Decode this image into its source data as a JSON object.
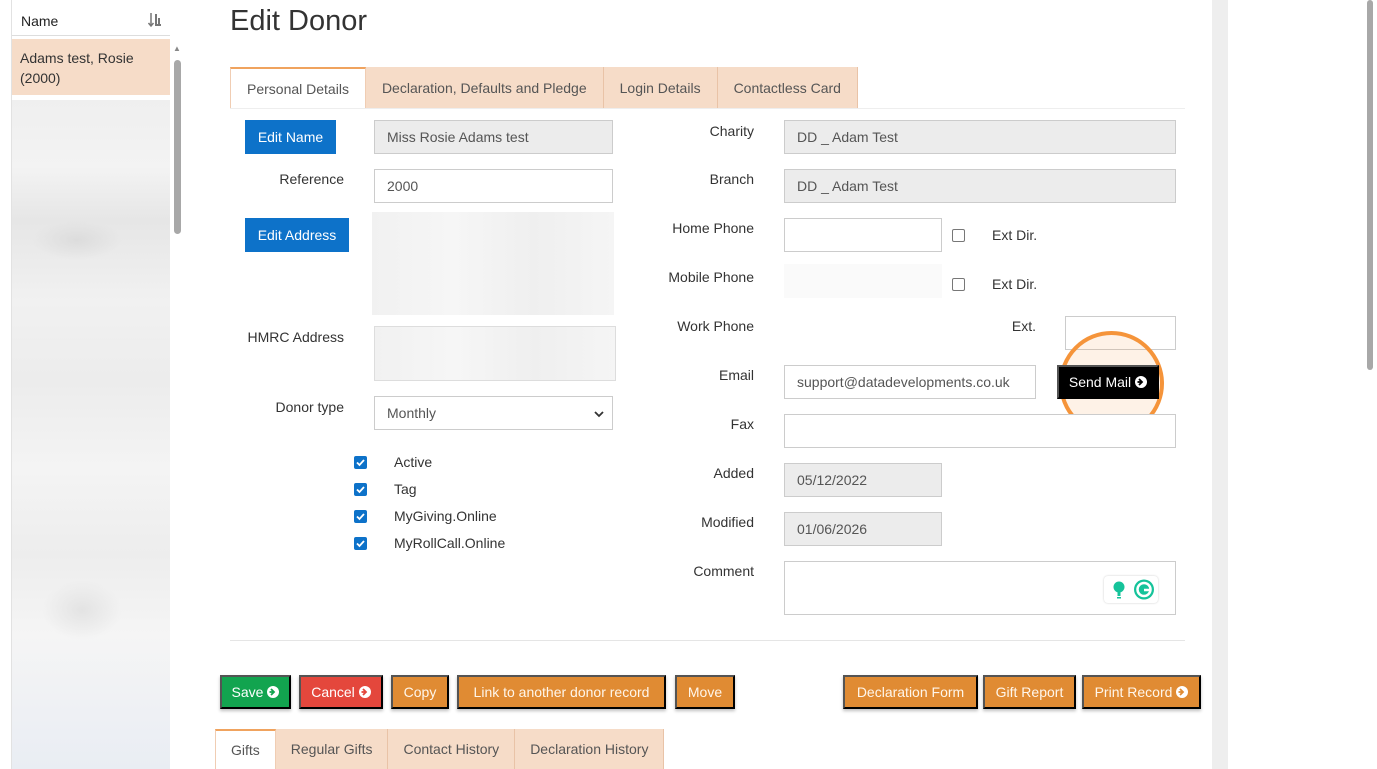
{
  "sidebar": {
    "header_label": "Name",
    "selected_item": "Adams test, Rosie (2000)"
  },
  "page": {
    "title": "Edit Donor"
  },
  "tabs": [
    {
      "label": "Personal Details",
      "active": true
    },
    {
      "label": "Declaration, Defaults and Pledge",
      "active": false
    },
    {
      "label": "Login Details",
      "active": false
    },
    {
      "label": "Contactless Card",
      "active": false
    }
  ],
  "left_form": {
    "edit_name_label": "Edit Name",
    "name_value": "Miss Rosie Adams test",
    "reference_label": "Reference",
    "reference_value": "2000",
    "edit_address_label": "Edit Address",
    "hmrc_label": "HMRC Address",
    "donor_type_label": "Donor type",
    "donor_type_value": "Monthly",
    "checkboxes": [
      {
        "label": "Active",
        "checked": true
      },
      {
        "label": "Tag",
        "checked": true
      },
      {
        "label": "MyGiving.Online",
        "checked": true
      },
      {
        "label": "MyRollCall.Online",
        "checked": true
      }
    ]
  },
  "right_form": {
    "charity_label": "Charity",
    "charity_value": "DD _ Adam Test",
    "branch_label": "Branch",
    "branch_value": "DD _ Adam Test",
    "home_phone_label": "Home Phone",
    "home_phone_value": "",
    "ext_dir_label": "Ext Dir.",
    "mobile_phone_label": "Mobile Phone",
    "mobile_ext_dir_label": "Ext Dir.",
    "work_phone_label": "Work Phone",
    "ext_label": "Ext.",
    "email_label": "Email",
    "email_value": "support@datadevelopments.co.uk",
    "send_mail_label": "Send Mail",
    "fax_label": "Fax",
    "fax_value": "",
    "added_label": "Added",
    "added_value": "05/12/2022",
    "modified_label": "Modified",
    "modified_value": "01/06/2026",
    "comment_label": "Comment",
    "comment_value": ""
  },
  "actions": {
    "save": "Save",
    "cancel": "Cancel",
    "copy": "Copy",
    "link": "Link to another donor record",
    "move": "Move",
    "declaration_form": "Declaration Form",
    "gift_report": "Gift Report",
    "print_record": "Print Record"
  },
  "bottom_tabs": [
    {
      "label": "Gifts",
      "active": true
    },
    {
      "label": "Regular Gifts",
      "active": false
    },
    {
      "label": "Contact History",
      "active": false
    },
    {
      "label": "Declaration History",
      "active": false
    }
  ],
  "colors": {
    "primary_blue": "#0d72c9",
    "tab_peach": "#f6dcc8",
    "save_green": "#12a44f",
    "cancel_red": "#e4473c",
    "action_orange": "#e08b33",
    "highlight_orange": "#f5943a"
  }
}
